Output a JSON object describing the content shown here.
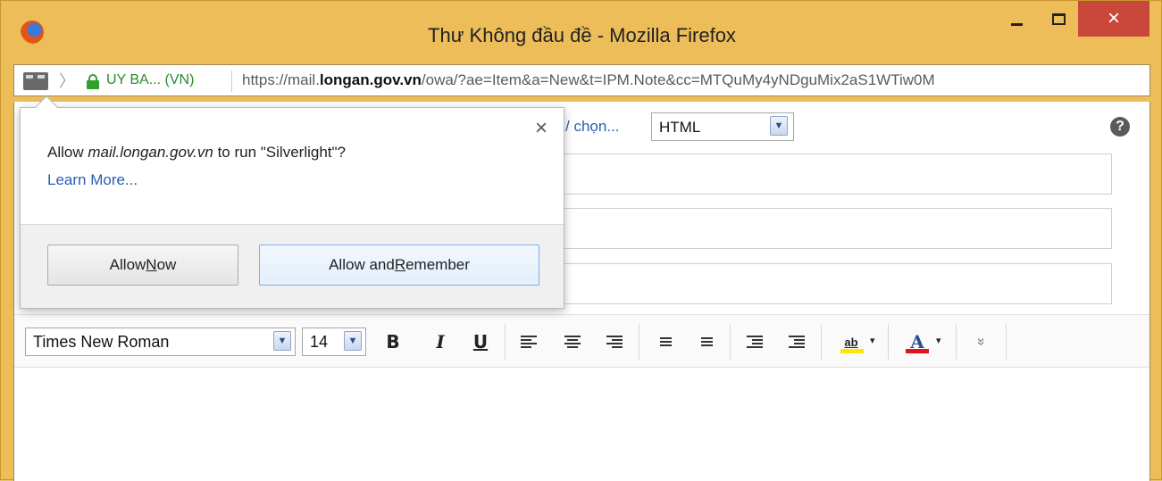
{
  "window": {
    "title": "Thư Không đầu đề - Mozilla Firefox",
    "app_icon": "firefox-icon",
    "controls": {
      "minimize_icon": "minimize-icon",
      "maximize_icon": "maximize-icon",
      "close_glyph": "×"
    }
  },
  "urlbar": {
    "identity": "UY BA... (VN)",
    "url_prefix": "https://mail.",
    "url_domain": "longan.gov.vn",
    "url_suffix": "/owa/?ae=Item&a=New&t=IPM.Note&cc=MTQuMy4yNDguMix2aS1WTiw0M"
  },
  "compose": {
    "options_link": "/ chọn...",
    "format_value": "HTML",
    "help_glyph": "?"
  },
  "toolbar": {
    "font_value": "Times New Roman",
    "size_value": "14",
    "bold_label": "B",
    "italic_label": "I",
    "underline_label": "U",
    "highlight_label": "ab",
    "font_color_label": "A",
    "more_glyph": "»",
    "dropdown_glyph": "▾",
    "select_glyph": "▼"
  },
  "popup": {
    "message_prefix": "Allow ",
    "message_site": "mail.longan.gov.vn",
    "message_suffix": " to run \"Silverlight\"?",
    "learn_more": "Learn More...",
    "close_glyph": "×",
    "allow_now_prefix": "Allow ",
    "allow_now_accel": "N",
    "allow_now_rest": "ow",
    "allow_remember_prefix": "Allow and ",
    "allow_remember_accel": "R",
    "allow_remember_rest": "emember"
  },
  "colors": {
    "titlebar": "#edbd5a",
    "close_button": "#c9483a",
    "secure_green": "#2b8a2e",
    "link_blue": "#2a5db0",
    "highlight_yellow": "#ffe600",
    "font_color_red": "#e0141d"
  }
}
